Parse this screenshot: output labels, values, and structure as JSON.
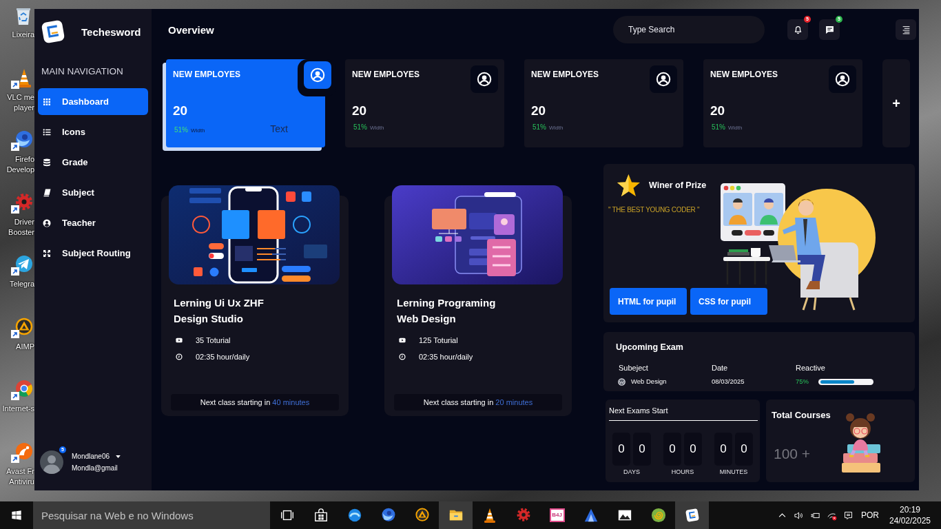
{
  "desktop_icons": [
    {
      "kind": "bin",
      "label": "Lixeira",
      "shortcut": false
    },
    {
      "kind": "cone",
      "label": "VLC me\nplayer",
      "shortcut": true
    },
    {
      "kind": "swirl",
      "label": "Firefo\nDevelop",
      "shortcut": true
    },
    {
      "kind": "gear",
      "label": "Driver\nBooster",
      "shortcut": true
    },
    {
      "kind": "plane",
      "label": "Telegra",
      "shortcut": true
    },
    {
      "kind": "triangle",
      "label": "AIMP",
      "shortcut": true
    },
    {
      "kind": "ring",
      "label": "Internet-s",
      "shortcut": true
    },
    {
      "kind": "orbit",
      "label": "Avast Fr\nAntiviru",
      "shortcut": true
    }
  ],
  "sidebar": {
    "brand": "Techesword",
    "heading": "MAIN NAVIGATION",
    "items": [
      {
        "kind": "grid",
        "label": "Dashboard",
        "selected": true
      },
      {
        "kind": "list",
        "label": "Icons",
        "selected": false
      },
      {
        "kind": "database",
        "label": "Grade",
        "selected": false
      },
      {
        "kind": "book",
        "label": "Subject",
        "selected": false
      },
      {
        "kind": "user",
        "label": "Teacher",
        "selected": false
      },
      {
        "kind": "expand",
        "label": "Subject Routing",
        "selected": false
      }
    ],
    "user": {
      "name": "Mondlane06",
      "email": "Mondla@gmail",
      "badge": "5"
    }
  },
  "header": {
    "title": "Overview",
    "search": {
      "placeholder": "Type Search"
    },
    "buttons": [
      {
        "kind": "bell",
        "badge": "5",
        "color": "#e5242b"
      },
      {
        "kind": "chat",
        "badge": "5",
        "color": "#2fb84f"
      },
      {
        "kind": "menu"
      }
    ]
  },
  "stat_cards": [
    {
      "title": "NEW EMPLOYES",
      "value": "20",
      "percent": "51%",
      "caption": "Width",
      "note": "Text",
      "selected": true
    },
    {
      "title": "NEW EMPLOYES",
      "value": "20",
      "percent": "51%",
      "caption": "Width",
      "selected": false
    },
    {
      "title": "NEW EMPLOYES",
      "value": "20",
      "percent": "51%",
      "caption": "Width",
      "selected": false
    },
    {
      "title": "NEW EMPLOYES",
      "value": "20",
      "percent": "51%",
      "caption": "Width",
      "selected": false
    }
  ],
  "add_card": {
    "label": "+"
  },
  "courses": [
    {
      "kind": "phone",
      "title": "Lerning Ui Ux ZHF\nDesign Studio",
      "tutorials": "35 Toturial",
      "duration": "02:35 hour/daily",
      "next_prefix": "Next class starting in",
      "next_time": "40 minutes"
    },
    {
      "kind": "tablet",
      "title": "Lerning Programing\nWeb Design",
      "tutorials": "125 Toturial",
      "duration": "02:35 hour/daily",
      "next_prefix": "Next class starting in",
      "next_time": "20 minutes"
    }
  ],
  "prize": {
    "title": "Winer of Prize",
    "quote": "\" THE BEST YOUNG CODER \"",
    "buttons": [
      "HTML for pupil",
      "CSS for pupil"
    ]
  },
  "upcoming_exam": {
    "title": "Upcoming Exam",
    "columns": [
      "Subeject",
      "Date",
      "Reactive"
    ],
    "rows": [
      {
        "subject": "Web Design",
        "date": "08/03/2025",
        "percent": "75%",
        "level": 0.66
      }
    ]
  },
  "countdown": {
    "title": "Next Exams Start",
    "units": [
      {
        "digits": [
          "0",
          "0"
        ],
        "label": "DAYS"
      },
      {
        "digits": [
          "0",
          "0"
        ],
        "label": "HOURS"
      },
      {
        "digits": [
          "0",
          "0"
        ],
        "label": "MINUTES"
      }
    ]
  },
  "total_courses": {
    "title": "Total Courses",
    "value": "100 +"
  },
  "taskbar": {
    "search": {
      "placeholder": "Pesquisar na Web e no Windows"
    },
    "apps": [
      {
        "kind": "taskview",
        "active": false
      },
      {
        "kind": "store",
        "active": false
      },
      {
        "kind": "wave",
        "active": false
      },
      {
        "kind": "swirl",
        "active": false
      },
      {
        "kind": "triangle",
        "active": false
      },
      {
        "kind": "folder",
        "active": true
      },
      {
        "kind": "cone",
        "active": false
      },
      {
        "kind": "gear",
        "active": false
      },
      {
        "kind": "tile",
        "label": "B4J",
        "active": false
      },
      {
        "kind": "tent",
        "active": false
      },
      {
        "kind": "picture",
        "active": false
      },
      {
        "kind": "spiral",
        "active": false
      },
      {
        "kind": "logo",
        "active": true
      }
    ],
    "tray": {
      "language": "POR",
      "time": "20:19",
      "date": "24/02/2025"
    }
  }
}
